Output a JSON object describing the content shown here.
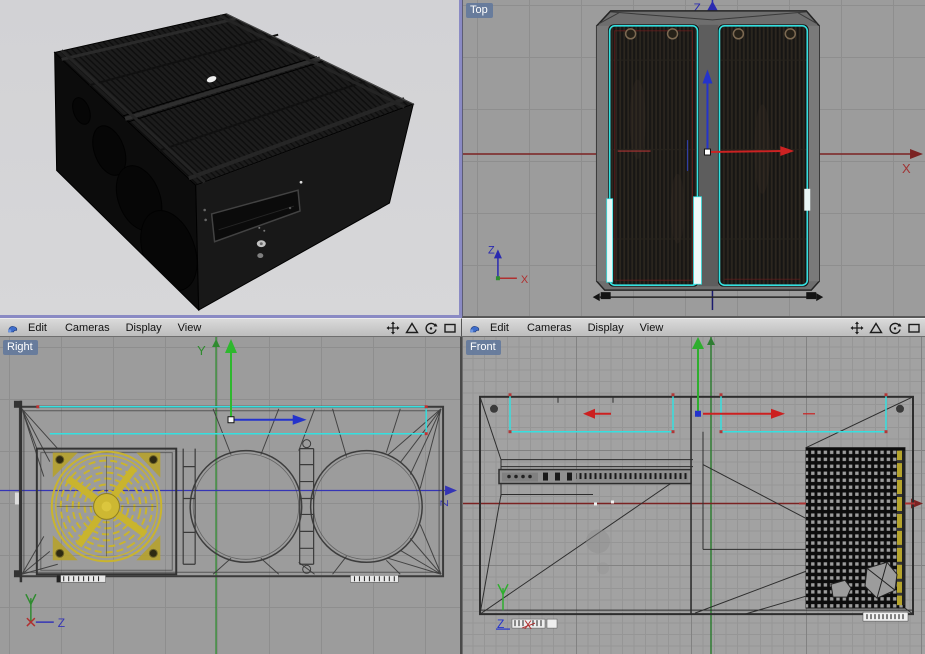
{
  "viewport_labels": {
    "top": "Top",
    "right_view": "Right",
    "front": "Front"
  },
  "viewport_menu": {
    "items": [
      "Edit",
      "Cameras",
      "Display",
      "View"
    ]
  },
  "toolbar_icons": [
    "move-view-tool",
    "scale-view-tool",
    "rotate-view-tool",
    "toggle-maximize-view-tool"
  ],
  "axis_labels": {
    "x": "X",
    "y": "Y",
    "z": "Z"
  },
  "colors": {
    "x_axis_dark_red": "#7b2222",
    "y_axis_green": "#2f8b2f",
    "z_axis_blue": "#3434b8",
    "selection_cyan": "#35e0e0",
    "selected_object_yellow": "#c9b42e",
    "active_viewport_border": "#8a8ac4",
    "viewport_label_bg": "#647a9c",
    "grid_bg": "#9c9c9c",
    "perspective_bg": "#d4d4d6"
  }
}
